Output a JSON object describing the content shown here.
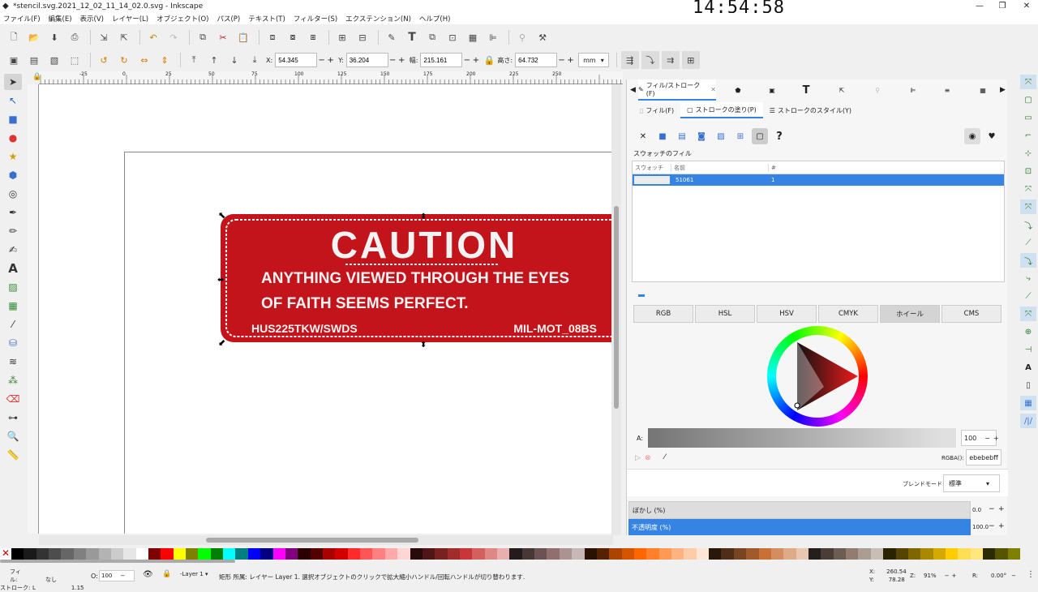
{
  "window": {
    "title": "*stencil.svg.2021_12_02_11_14_02.0.svg - Inkscape",
    "clock": "14:54:58"
  },
  "menu": [
    "ファイル(F)",
    "編集(E)",
    "表示(V)",
    "レイヤー(L)",
    "オブジェクト(O)",
    "パス(P)",
    "テキスト(T)",
    "フィルター(S)",
    "エクステンション(N)",
    "ヘルプ(H)"
  ],
  "controls": {
    "x_label": "X:",
    "x": "54.345",
    "y_label": "Y:",
    "y": "36.204",
    "w_label": "幅:",
    "w": "215.161",
    "h_label": "高さ:",
    "h": "64.732",
    "unit": "mm"
  },
  "ruler_ticks": [
    "-25",
    "0",
    "25",
    "50",
    "75",
    "100",
    "125",
    "150",
    "175",
    "200",
    "225",
    "250"
  ],
  "artwork": {
    "heading": "CAUTION",
    "line1": "ANYTHING VIEWED THROUGH THE EYES",
    "line2": "OF FAITH SEEMS PERFECT.",
    "left_code": "HUS225TKW/SWDS",
    "right_code": "MIL-MOT_08BS",
    "fill_color": "#c4141b"
  },
  "panel": {
    "tab_label": "フィル/ストローク(F)",
    "subtabs": [
      "フィル(F)",
      "ストロークの塗り(P)",
      "ストロークのスタイル(Y)"
    ],
    "swatch_heading": "スウォッチのフィル",
    "table_headers": [
      "スウォッチ",
      "名前",
      "#"
    ],
    "table_row": {
      "name": "51061",
      "count": "1"
    },
    "color_modes": [
      "RGB",
      "HSL",
      "HSV",
      "CMYK",
      "ホイール",
      "CMS"
    ],
    "alpha_label": "A:",
    "alpha_value": "100",
    "rgba_label": "RGBA():",
    "rgba_value": "ebebebff",
    "blend_label": "ブレンドモード:",
    "blend_value": "標準",
    "blur_label": "ぼかし (%)",
    "blur_value": "0.0",
    "opacity_label": "不透明度 (%)",
    "opacity_value": "100.0"
  },
  "status": {
    "fill_label": "フィル:",
    "fill_value": "なし",
    "stroke_label": "ストローク:",
    "stroke_value": "L",
    "stroke_width": "1.15",
    "o_label": "O:",
    "o_value": "100",
    "layer": "-Layer 1",
    "message": "矩形 所属: レイヤー Layer 1. 選択オブジェクトのクリックで拡大縮小ハンドル/回転ハンドルが切り替わります.",
    "cx": "260.54",
    "cy": "78.28",
    "x_label": "X:",
    "y_label": "Y:",
    "zoom_label": "Z:",
    "zoom": "91%",
    "rot_label": "R:",
    "rotation": "0.00°"
  },
  "colors": {
    "accent": "#3584e4",
    "caution_red": "#c4141b"
  }
}
